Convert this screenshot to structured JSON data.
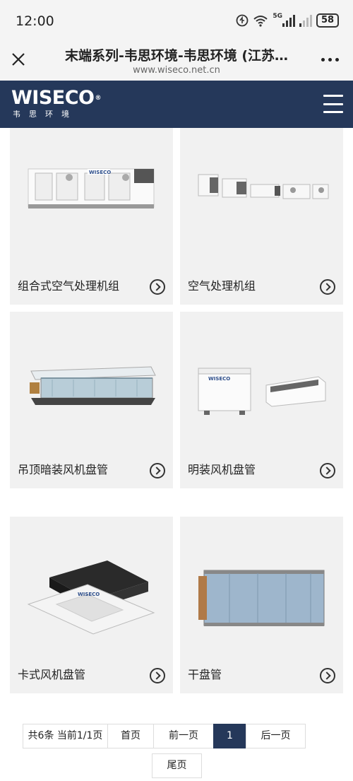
{
  "status_bar": {
    "time": "12:00",
    "network_label": "5G",
    "battery": "58"
  },
  "browser": {
    "title": "末端系列-韦思环境-韦思环境 (江苏…",
    "url": "www.wiseco.net.cn"
  },
  "site_header": {
    "logo_text": "WISECO",
    "logo_registered": "®",
    "logo_subtitle": "韦思环境"
  },
  "products": [
    {
      "label": "组合式空气处理机组",
      "image": "combined-ahu-image"
    },
    {
      "label": "空气处理机组",
      "image": "ahu-units-image"
    },
    {
      "label": "吊顶暗装风机盘管",
      "image": "ceiling-concealed-fcu-image"
    },
    {
      "label": "明装风机盘管",
      "image": "exposed-fcu-image"
    },
    {
      "label": "卡式风机盘管",
      "image": "cassette-fcu-image"
    },
    {
      "label": "干盘管",
      "image": "dry-coil-image"
    }
  ],
  "pagination": {
    "summary": "共6条 当前1/1页",
    "first": "首页",
    "prev": "前一页",
    "current": "1",
    "next": "后一页",
    "last": "尾页"
  },
  "colors": {
    "header_bg": "#25385a",
    "card_bg": "#f1f1f1",
    "accent": "#25385a"
  }
}
